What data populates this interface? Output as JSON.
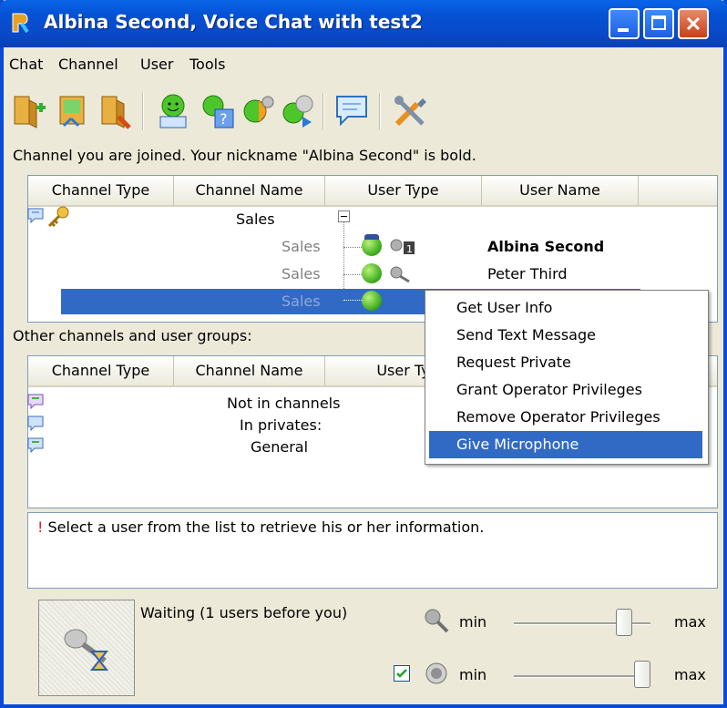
{
  "window": {
    "title": "Albina Second, Voice Chat with test2"
  },
  "menu": [
    "Chat",
    "Channel",
    "User",
    "Tools"
  ],
  "toolbar_icons": [
    "join-channel-icon",
    "leave-channel-icon",
    "exit-icon",
    "user-info-icon",
    "user-help-icon",
    "sound-settings-icon",
    "user-network-icon",
    "send-message-icon",
    "settings-tools-icon"
  ],
  "info_line": "Channel you are joined. Your nickname \"Albina Second\" is bold.",
  "list1": {
    "columns": [
      "Channel Type",
      "Channel Name",
      "User Type",
      "User Name"
    ],
    "channel_name": "Sales",
    "rows": [
      {
        "channel": "Sales",
        "user": "Albina Second"
      },
      {
        "channel": "Sales",
        "user": "Peter Third"
      },
      {
        "channel": "Sales",
        "user": ""
      }
    ]
  },
  "other_label": "Other channels and user groups:",
  "list2": {
    "columns": [
      "Channel Type",
      "Channel Name",
      "User Ty"
    ],
    "rows": [
      "Not in channels",
      "In privates:",
      "General"
    ]
  },
  "context_menu": [
    "Get User Info",
    "Send Text Message",
    "Request Private",
    "Grant Operator Privileges",
    "Remove Operator Privileges",
    "Give Microphone"
  ],
  "status": {
    "mark": "!",
    "text": "Select a user from the list to retrieve his or her information."
  },
  "bottom": {
    "waiting": "Waiting (1 users before you)",
    "min_label": "min",
    "max_label": "max",
    "mic_volume_level": 0.85,
    "speaker_volume_level": 1.0,
    "speaker_enabled": true
  },
  "colors": {
    "selection": "#316ac5",
    "titlebar": "#0a4ad8"
  }
}
